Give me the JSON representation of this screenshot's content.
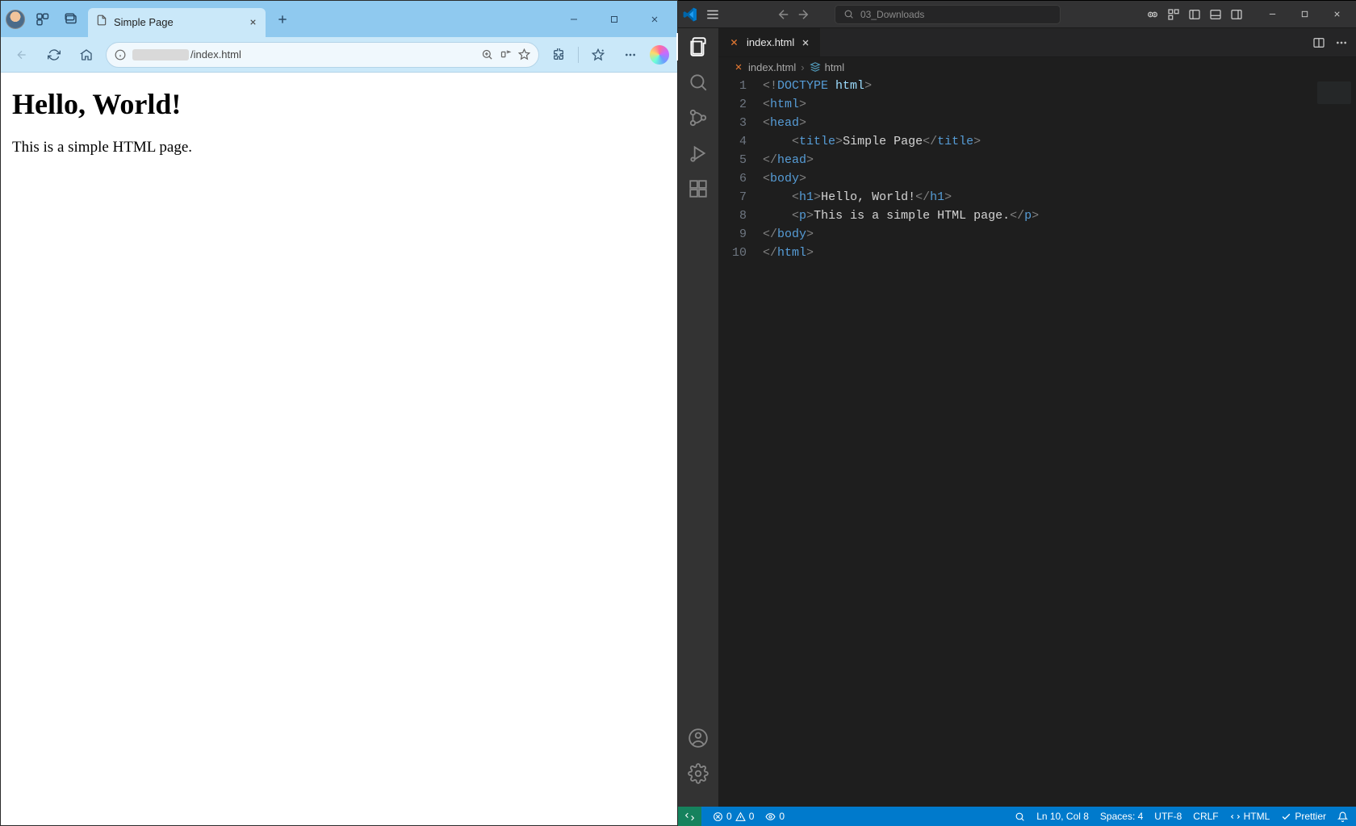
{
  "browser": {
    "tab_title": "Simple Page",
    "address_visible": "/index.html",
    "page": {
      "heading": "Hello, World!",
      "paragraph": "This is a simple HTML page."
    }
  },
  "vscode": {
    "search_text": "03_Downloads",
    "tab": {
      "filename": "index.html"
    },
    "breadcrumb": {
      "file": "index.html",
      "node": "html"
    },
    "lines": [
      {
        "n": "1",
        "html": "<span class='punct'>&lt;!</span><span class='doctype'>DOCTYPE</span> <span class='attr'>html</span><span class='punct'>&gt;</span>"
      },
      {
        "n": "2",
        "html": "<span class='punct'>&lt;</span><span class='tag'>html</span><span class='punct'>&gt;</span>"
      },
      {
        "n": "3",
        "html": "<span class='punct'>&lt;</span><span class='tag'>head</span><span class='punct'>&gt;</span>"
      },
      {
        "n": "4",
        "html": "    <span class='punct'>&lt;</span><span class='tag'>title</span><span class='punct'>&gt;</span><span class='txt'>Simple Page</span><span class='punct'>&lt;/</span><span class='tag'>title</span><span class='punct'>&gt;</span>"
      },
      {
        "n": "5",
        "html": "<span class='punct'>&lt;/</span><span class='tag'>head</span><span class='punct'>&gt;</span>"
      },
      {
        "n": "6",
        "html": "<span class='punct'>&lt;</span><span class='tag'>body</span><span class='punct'>&gt;</span>"
      },
      {
        "n": "7",
        "html": "    <span class='punct'>&lt;</span><span class='tag'>h1</span><span class='punct'>&gt;</span><span class='txt'>Hello, World!</span><span class='punct'>&lt;/</span><span class='tag'>h1</span><span class='punct'>&gt;</span>"
      },
      {
        "n": "8",
        "html": "    <span class='punct'>&lt;</span><span class='tag'>p</span><span class='punct'>&gt;</span><span class='txt'>This is a simple HTML page.</span><span class='punct'>&lt;/</span><span class='tag'>p</span><span class='punct'>&gt;</span>"
      },
      {
        "n": "9",
        "html": "<span class='punct'>&lt;/</span><span class='tag'>body</span><span class='punct'>&gt;</span>"
      },
      {
        "n": "10",
        "html": "<span class='punct'>&lt;/</span><span class='tag'>html</span><span class='punct'>&gt;</span>"
      }
    ],
    "status": {
      "errors": "0",
      "warnings": "0",
      "ports": "0",
      "ln_col": "Ln 10, Col 8",
      "spaces": "Spaces: 4",
      "encoding": "UTF-8",
      "eol": "CRLF",
      "lang": "HTML",
      "prettier": "Prettier"
    }
  }
}
